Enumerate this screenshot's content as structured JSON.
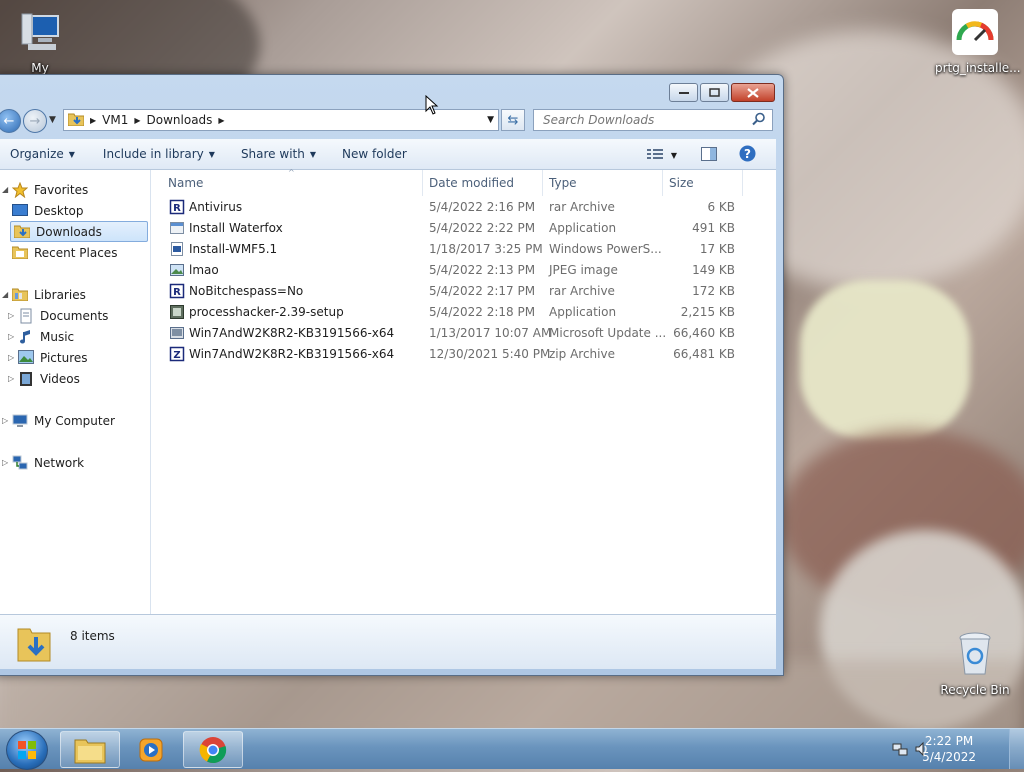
{
  "desktop": {
    "icons": [
      {
        "label": "My Computer"
      },
      {
        "label": "prtg_installe..."
      },
      {
        "label": "Recycle Bin"
      }
    ]
  },
  "window": {
    "address": {
      "segments": [
        "VM1",
        "Downloads"
      ]
    },
    "search": {
      "placeholder": "Search Downloads"
    },
    "toolbar": {
      "organize": "Organize",
      "include_in_library": "Include in library",
      "share_with": "Share with",
      "new_folder": "New folder"
    },
    "nav": {
      "favorites": "Favorites",
      "desktop": "Desktop",
      "downloads": "Downloads",
      "recent_places": "Recent Places",
      "libraries": "Libraries",
      "documents": "Documents",
      "music": "Music",
      "pictures": "Pictures",
      "videos": "Videos",
      "my_computer": "My Computer",
      "network": "Network"
    },
    "columns": {
      "name": "Name",
      "date_modified": "Date modified",
      "type": "Type",
      "size": "Size"
    },
    "files": [
      {
        "name": "Antivirus",
        "date": "5/4/2022 2:16 PM",
        "type": "rar Archive",
        "size": "6 KB",
        "icon": "rar-archive-icon"
      },
      {
        "name": "Install Waterfox",
        "date": "5/4/2022 2:22 PM",
        "type": "Application",
        "size": "491 KB",
        "icon": "application-icon"
      },
      {
        "name": "Install-WMF5.1",
        "date": "1/18/2017 3:25 PM",
        "type": "Windows PowerS...",
        "size": "17 KB",
        "icon": "powershell-script-icon"
      },
      {
        "name": "lmao",
        "date": "5/4/2022 2:13 PM",
        "type": "JPEG image",
        "size": "149 KB",
        "icon": "jpeg-image-icon"
      },
      {
        "name": "NoBitchespass=No",
        "date": "5/4/2022 2:17 PM",
        "type": "rar Archive",
        "size": "172 KB",
        "icon": "rar-archive-icon"
      },
      {
        "name": "processhacker-2.39-setup",
        "date": "5/4/2022 2:18 PM",
        "type": "Application",
        "size": "2,215 KB",
        "icon": "installer-icon"
      },
      {
        "name": "Win7AndW2K8R2-KB3191566-x64",
        "date": "1/13/2017 10:07 AM",
        "type": "Microsoft Update ...",
        "size": "66,460 KB",
        "icon": "msu-update-icon"
      },
      {
        "name": "Win7AndW2K8R2-KB3191566-x64",
        "date": "12/30/2021 5:40 PM",
        "type": "zip Archive",
        "size": "66,481 KB",
        "icon": "zip-archive-icon"
      }
    ],
    "details": {
      "count": "8 items"
    }
  },
  "taskbar": {
    "time": "2:22 PM",
    "date": "5/4/2022"
  }
}
